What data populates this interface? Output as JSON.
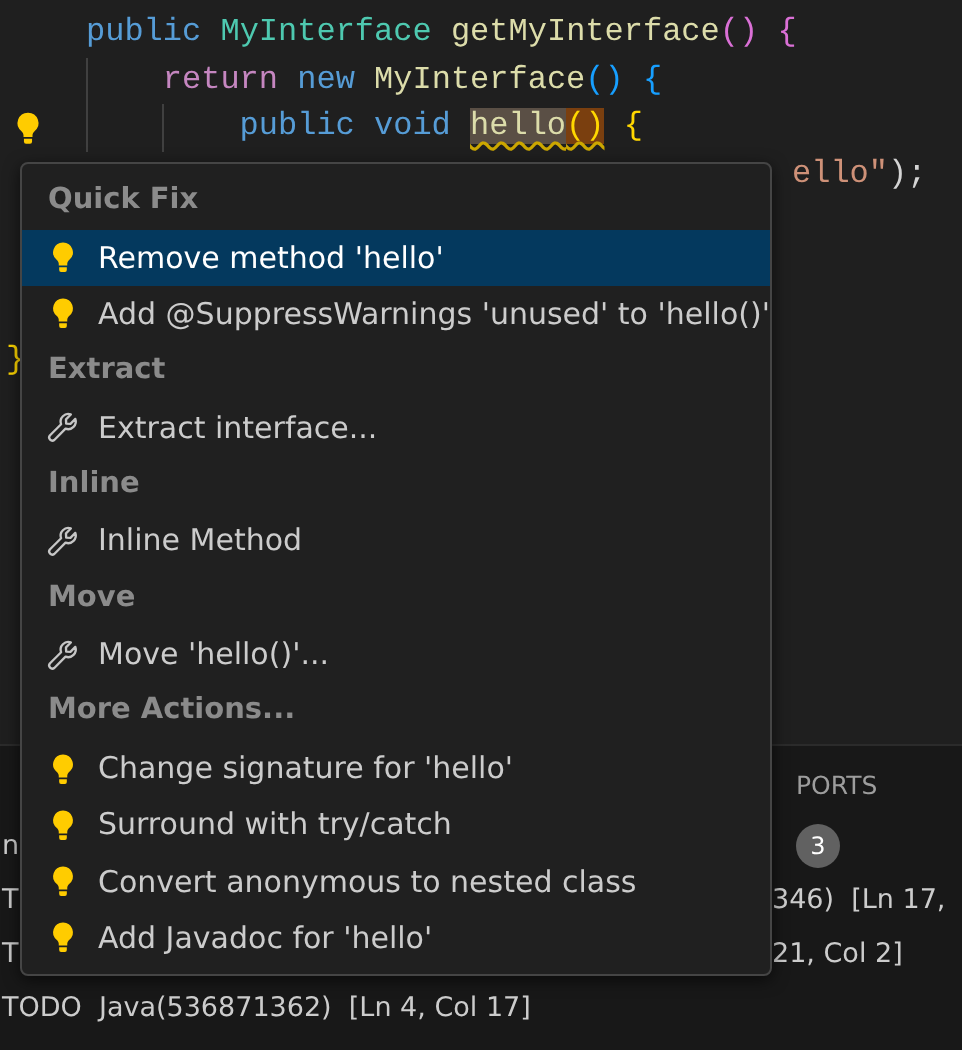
{
  "editor": {
    "lines": [
      {
        "kind": "full",
        "gutter_bulb": false,
        "tokens": [
          {
            "text": "public",
            "kind": "keyword"
          },
          {
            "text": "MyInterface",
            "kind": "type"
          },
          {
            "text": "getMyInterface",
            "kind": "method"
          },
          {
            "text": "()",
            "kind": "bracket1"
          },
          {
            "text": "{",
            "kind": "bracket1"
          }
        ],
        "children": [
          {
            "kind": "full",
            "gutter_bulb": false,
            "tokens": [
              {
                "text": "return",
                "kind": "control"
              },
              {
                "text": "new",
                "kind": "keyword"
              },
              {
                "text": "MyInterface",
                "kind": "method"
              },
              {
                "text": "()",
                "kind": "bracket2"
              },
              {
                "text": "{",
                "kind": "bracket2"
              }
            ],
            "children": [
              {
                "kind": "full",
                "gutter_bulb": true,
                "tokens": [
                  {
                    "text": "public",
                    "kind": "keyword"
                  },
                  {
                    "text": "void",
                    "kind": "keyword"
                  },
                  {
                    "text": "hello",
                    "kind": "symbol-warning"
                  },
                  {
                    "text": "()",
                    "kind": "bracket-warning"
                  },
                  {
                    "text": "{",
                    "kind": "bracket3"
                  }
                ],
                "children": [
                  {
                    "kind": "right-fragment",
                    "gutter_bulb": false,
                    "tokens": [
                      {
                        "text": "ello\"",
                        "kind": "string"
                      },
                      {
                        "text": ");",
                        "kind": "plain"
                      }
                    ]
                  }
                ]
              }
            ]
          }
        ]
      },
      {
        "kind": "left-fragment",
        "gutter_bulb": false,
        "tokens": [
          {
            "text": "}",
            "kind": "bracket3"
          }
        ]
      }
    ]
  },
  "panel": {
    "tabs": [
      {
        "label": "PORTS",
        "selected": false
      }
    ],
    "rows": [
      {
        "left": "n",
        "right": "",
        "badge": "3"
      },
      {
        "left": "T",
        "right": "346)  [Ln 17,",
        "badge": ""
      },
      {
        "left": "T",
        "right": "21, Col 2]",
        "badge": ""
      },
      {
        "left": "TODO  Java(536871362)  [Ln 4, Col 17]",
        "right": "",
        "badge": ""
      }
    ]
  },
  "menu": {
    "sections": [
      {
        "title": "Quick Fix",
        "items": [
          {
            "label": "Remove method 'hello'",
            "kind": "fix",
            "selected": true
          },
          {
            "label": "Add @SuppressWarnings 'unused' to 'hello()'",
            "kind": "fix",
            "selected": false
          }
        ]
      },
      {
        "title": "Extract",
        "items": [
          {
            "label": "Extract interface...",
            "kind": "refactor",
            "selected": false
          }
        ]
      },
      {
        "title": "Inline",
        "items": [
          {
            "label": "Inline Method",
            "kind": "refactor",
            "selected": false
          }
        ]
      },
      {
        "title": "Move",
        "items": [
          {
            "label": "Move 'hello()'...",
            "kind": "refactor",
            "selected": false
          }
        ]
      },
      {
        "title": "More Actions...",
        "items": [
          {
            "label": "Change signature for 'hello'",
            "kind": "fix",
            "selected": false
          },
          {
            "label": "Surround with try/catch",
            "kind": "fix",
            "selected": false
          },
          {
            "label": "Convert anonymous to nested class",
            "kind": "fix",
            "selected": false
          },
          {
            "label": "Add Javadoc for 'hello'",
            "kind": "fix",
            "selected": false
          }
        ]
      }
    ]
  }
}
